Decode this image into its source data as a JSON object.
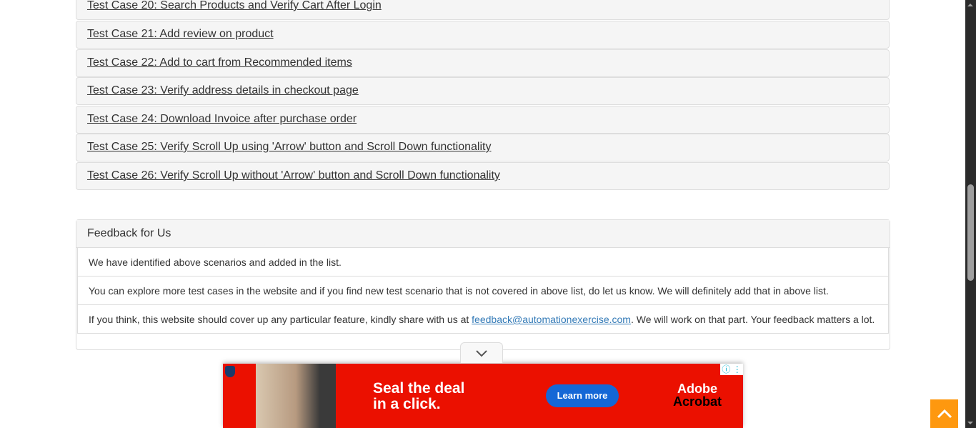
{
  "test_cases": [
    "Test Case 20: Search Products and Verify Cart After Login",
    "Test Case 21: Add review on product",
    "Test Case 22: Add to cart from Recommended items",
    "Test Case 23: Verify address details in checkout page",
    "Test Case 24: Download Invoice after purchase order",
    "Test Case 25: Verify Scroll Up using 'Arrow' button and Scroll Down functionality",
    "Test Case 26: Verify Scroll Up without 'Arrow' button and Scroll Down functionality"
  ],
  "feedback": {
    "title": "Feedback for Us",
    "item1": "We have identified above scenarios and added in the list.",
    "item2": "You can explore more test cases in the website and if you find new test scenario that is not covered in above list, do let us know. We will definitely add that in above list.",
    "item3_pre": "If you think, this website should cover up any particular feature, kindly share with us at ",
    "item3_link": "feedback@automationexercise.com",
    "item3_post": ". We will work on that part. Your feedback matters a lot."
  },
  "ad": {
    "headline1": "Seal the deal",
    "headline2": "in a click.",
    "cta": "Learn more",
    "brand1": "Adobe",
    "brand2": "Acrobat",
    "bg_color": "#eb1000"
  },
  "colors": {
    "accent": "#fe980f",
    "link": "#337ab7"
  }
}
